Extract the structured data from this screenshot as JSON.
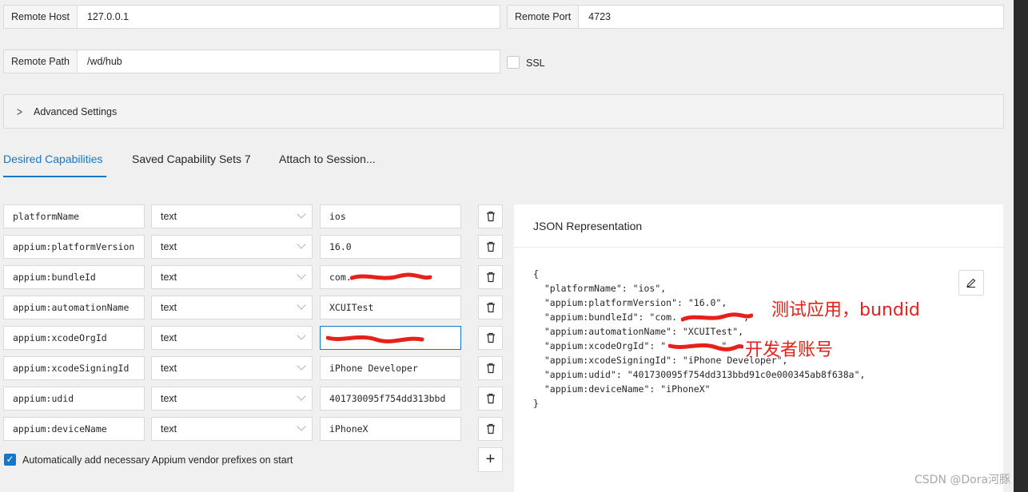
{
  "connection": {
    "remote_host": {
      "label": "Remote Host",
      "value": "127.0.0.1"
    },
    "remote_port": {
      "label": "Remote Port",
      "value": "4723"
    },
    "remote_path": {
      "label": "Remote Path",
      "value": "/wd/hub"
    },
    "ssl": {
      "label": "SSL",
      "checked": false
    }
  },
  "advanced": {
    "label": "Advanced Settings",
    "icon": "chevron-right-icon"
  },
  "tabs": [
    {
      "label": "Desired Capabilities",
      "active": true
    },
    {
      "label": "Saved Capability Sets 7",
      "active": false
    },
    {
      "label": "Attach to Session...",
      "active": false
    }
  ],
  "capabilities": [
    {
      "name": "platformName",
      "type": "text",
      "value": "ios"
    },
    {
      "name": "appium:platformVersion",
      "type": "text",
      "value": "16.0"
    },
    {
      "name": "appium:bundleId",
      "type": "text",
      "value": "com."
    },
    {
      "name": "appium:automationName",
      "type": "text",
      "value": "XCUITest"
    },
    {
      "name": "appium:xcodeOrgId",
      "type": "text",
      "value": ""
    },
    {
      "name": "appium:xcodeSigningId",
      "type": "text",
      "value": "iPhone Developer"
    },
    {
      "name": "appium:udid",
      "type": "text",
      "value": "401730095f754dd313bbd"
    },
    {
      "name": "appium:deviceName",
      "type": "text",
      "value": "iPhoneX"
    }
  ],
  "auto_prefix": {
    "label": "Automatically add necessary Appium vendor prefixes on start",
    "checked": true
  },
  "json_panel": {
    "title": "JSON Representation",
    "code": "{\n  \"platformName\": \"ios\",\n  \"appium:platformVersion\": \"16.0\",\n  \"appium:bundleId\": \"com.           \",\n  \"appium:automationName\": \"XCUITest\",\n  \"appium:xcodeOrgId\": \"          \",\n  \"appium:xcodeSigningId\": \"iPhone Developer\",\n  \"appium:udid\": \"401730095f754dd313bbd91c0e000345ab8f638a\",\n  \"appium:deviceName\": \"iPhoneX\"\n}"
  },
  "annotations": {
    "bundle_note": "测试应用，bundid",
    "org_note": "开发者账号"
  },
  "watermark": "CSDN @Dora河豚",
  "colors": {
    "accent": "#1677c9",
    "annotation": "#e8201a"
  }
}
